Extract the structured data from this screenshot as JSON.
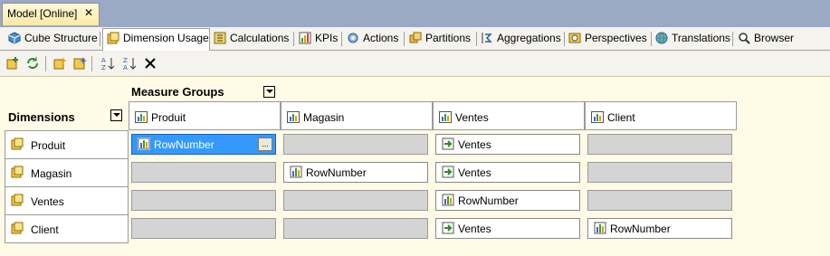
{
  "document_tab": {
    "title": "Model [Online]",
    "close": "✕"
  },
  "designer_tabs": [
    {
      "label": "Cube Structure",
      "icon": "cube-structure-icon"
    },
    {
      "label": "Dimension Usage",
      "icon": "dimension-usage-icon",
      "active": true
    },
    {
      "label": "Calculations",
      "icon": "calculations-icon"
    },
    {
      "label": "KPIs",
      "icon": "kpi-icon"
    },
    {
      "label": "Actions",
      "icon": "actions-icon"
    },
    {
      "label": "Partitions",
      "icon": "partitions-icon"
    },
    {
      "label": "Aggregations",
      "icon": "aggregations-icon"
    },
    {
      "label": "Perspectives",
      "icon": "perspectives-icon"
    },
    {
      "label": "Translations",
      "icon": "translations-icon"
    },
    {
      "label": "Browser",
      "icon": "browser-icon"
    }
  ],
  "grid": {
    "measure_groups_title": "Measure Groups",
    "dimensions_title": "Dimensions",
    "measure_groups": [
      "Produit",
      "Magasin",
      "Ventes",
      "Client"
    ],
    "dimensions": [
      "Produit",
      "Magasin",
      "Ventes",
      "Client"
    ],
    "cells": [
      [
        {
          "text": "RowNumber",
          "type": "fact",
          "selected": true
        },
        {
          "type": "empty"
        },
        {
          "text": "Ventes",
          "type": "referenced"
        },
        {
          "type": "empty"
        }
      ],
      [
        {
          "type": "empty"
        },
        {
          "text": "RowNumber",
          "type": "fact"
        },
        {
          "text": "Ventes",
          "type": "referenced"
        },
        {
          "type": "empty"
        }
      ],
      [
        {
          "type": "empty"
        },
        {
          "type": "empty"
        },
        {
          "text": "RowNumber",
          "type": "fact"
        },
        {
          "type": "empty"
        }
      ],
      [
        {
          "type": "empty"
        },
        {
          "type": "empty"
        },
        {
          "text": "Ventes",
          "type": "referenced"
        },
        {
          "text": "RowNumber",
          "type": "fact"
        }
      ]
    ],
    "ellipsis": "..."
  }
}
